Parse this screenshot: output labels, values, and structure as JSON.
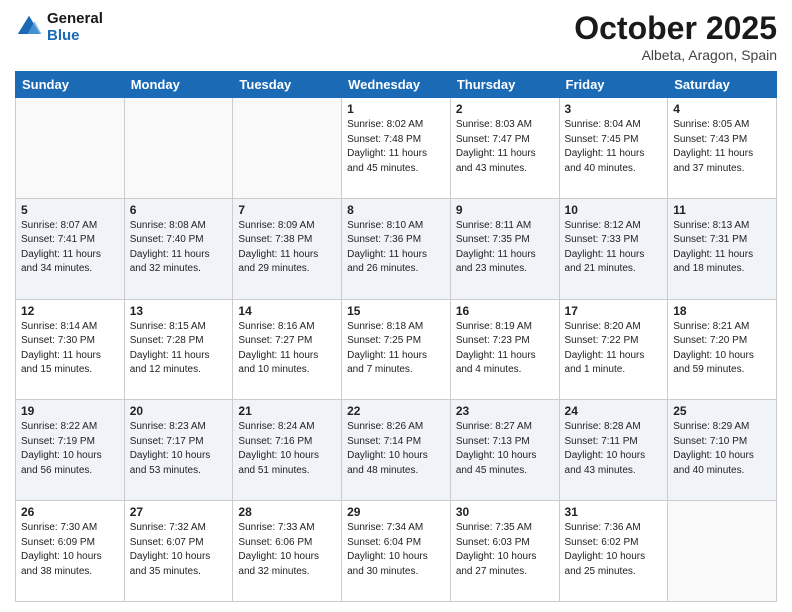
{
  "logo": {
    "line1": "General",
    "line2": "Blue"
  },
  "title": "October 2025",
  "location": "Albeta, Aragon, Spain",
  "days_of_week": [
    "Sunday",
    "Monday",
    "Tuesday",
    "Wednesday",
    "Thursday",
    "Friday",
    "Saturday"
  ],
  "weeks": [
    [
      {
        "day": "",
        "info": ""
      },
      {
        "day": "",
        "info": ""
      },
      {
        "day": "",
        "info": ""
      },
      {
        "day": "1",
        "info": "Sunrise: 8:02 AM\nSunset: 7:48 PM\nDaylight: 11 hours\nand 45 minutes."
      },
      {
        "day": "2",
        "info": "Sunrise: 8:03 AM\nSunset: 7:47 PM\nDaylight: 11 hours\nand 43 minutes."
      },
      {
        "day": "3",
        "info": "Sunrise: 8:04 AM\nSunset: 7:45 PM\nDaylight: 11 hours\nand 40 minutes."
      },
      {
        "day": "4",
        "info": "Sunrise: 8:05 AM\nSunset: 7:43 PM\nDaylight: 11 hours\nand 37 minutes."
      }
    ],
    [
      {
        "day": "5",
        "info": "Sunrise: 8:07 AM\nSunset: 7:41 PM\nDaylight: 11 hours\nand 34 minutes."
      },
      {
        "day": "6",
        "info": "Sunrise: 8:08 AM\nSunset: 7:40 PM\nDaylight: 11 hours\nand 32 minutes."
      },
      {
        "day": "7",
        "info": "Sunrise: 8:09 AM\nSunset: 7:38 PM\nDaylight: 11 hours\nand 29 minutes."
      },
      {
        "day": "8",
        "info": "Sunrise: 8:10 AM\nSunset: 7:36 PM\nDaylight: 11 hours\nand 26 minutes."
      },
      {
        "day": "9",
        "info": "Sunrise: 8:11 AM\nSunset: 7:35 PM\nDaylight: 11 hours\nand 23 minutes."
      },
      {
        "day": "10",
        "info": "Sunrise: 8:12 AM\nSunset: 7:33 PM\nDaylight: 11 hours\nand 21 minutes."
      },
      {
        "day": "11",
        "info": "Sunrise: 8:13 AM\nSunset: 7:31 PM\nDaylight: 11 hours\nand 18 minutes."
      }
    ],
    [
      {
        "day": "12",
        "info": "Sunrise: 8:14 AM\nSunset: 7:30 PM\nDaylight: 11 hours\nand 15 minutes."
      },
      {
        "day": "13",
        "info": "Sunrise: 8:15 AM\nSunset: 7:28 PM\nDaylight: 11 hours\nand 12 minutes."
      },
      {
        "day": "14",
        "info": "Sunrise: 8:16 AM\nSunset: 7:27 PM\nDaylight: 11 hours\nand 10 minutes."
      },
      {
        "day": "15",
        "info": "Sunrise: 8:18 AM\nSunset: 7:25 PM\nDaylight: 11 hours\nand 7 minutes."
      },
      {
        "day": "16",
        "info": "Sunrise: 8:19 AM\nSunset: 7:23 PM\nDaylight: 11 hours\nand 4 minutes."
      },
      {
        "day": "17",
        "info": "Sunrise: 8:20 AM\nSunset: 7:22 PM\nDaylight: 11 hours\nand 1 minute."
      },
      {
        "day": "18",
        "info": "Sunrise: 8:21 AM\nSunset: 7:20 PM\nDaylight: 10 hours\nand 59 minutes."
      }
    ],
    [
      {
        "day": "19",
        "info": "Sunrise: 8:22 AM\nSunset: 7:19 PM\nDaylight: 10 hours\nand 56 minutes."
      },
      {
        "day": "20",
        "info": "Sunrise: 8:23 AM\nSunset: 7:17 PM\nDaylight: 10 hours\nand 53 minutes."
      },
      {
        "day": "21",
        "info": "Sunrise: 8:24 AM\nSunset: 7:16 PM\nDaylight: 10 hours\nand 51 minutes."
      },
      {
        "day": "22",
        "info": "Sunrise: 8:26 AM\nSunset: 7:14 PM\nDaylight: 10 hours\nand 48 minutes."
      },
      {
        "day": "23",
        "info": "Sunrise: 8:27 AM\nSunset: 7:13 PM\nDaylight: 10 hours\nand 45 minutes."
      },
      {
        "day": "24",
        "info": "Sunrise: 8:28 AM\nSunset: 7:11 PM\nDaylight: 10 hours\nand 43 minutes."
      },
      {
        "day": "25",
        "info": "Sunrise: 8:29 AM\nSunset: 7:10 PM\nDaylight: 10 hours\nand 40 minutes."
      }
    ],
    [
      {
        "day": "26",
        "info": "Sunrise: 7:30 AM\nSunset: 6:09 PM\nDaylight: 10 hours\nand 38 minutes."
      },
      {
        "day": "27",
        "info": "Sunrise: 7:32 AM\nSunset: 6:07 PM\nDaylight: 10 hours\nand 35 minutes."
      },
      {
        "day": "28",
        "info": "Sunrise: 7:33 AM\nSunset: 6:06 PM\nDaylight: 10 hours\nand 32 minutes."
      },
      {
        "day": "29",
        "info": "Sunrise: 7:34 AM\nSunset: 6:04 PM\nDaylight: 10 hours\nand 30 minutes."
      },
      {
        "day": "30",
        "info": "Sunrise: 7:35 AM\nSunset: 6:03 PM\nDaylight: 10 hours\nand 27 minutes."
      },
      {
        "day": "31",
        "info": "Sunrise: 7:36 AM\nSunset: 6:02 PM\nDaylight: 10 hours\nand 25 minutes."
      },
      {
        "day": "",
        "info": ""
      }
    ]
  ]
}
